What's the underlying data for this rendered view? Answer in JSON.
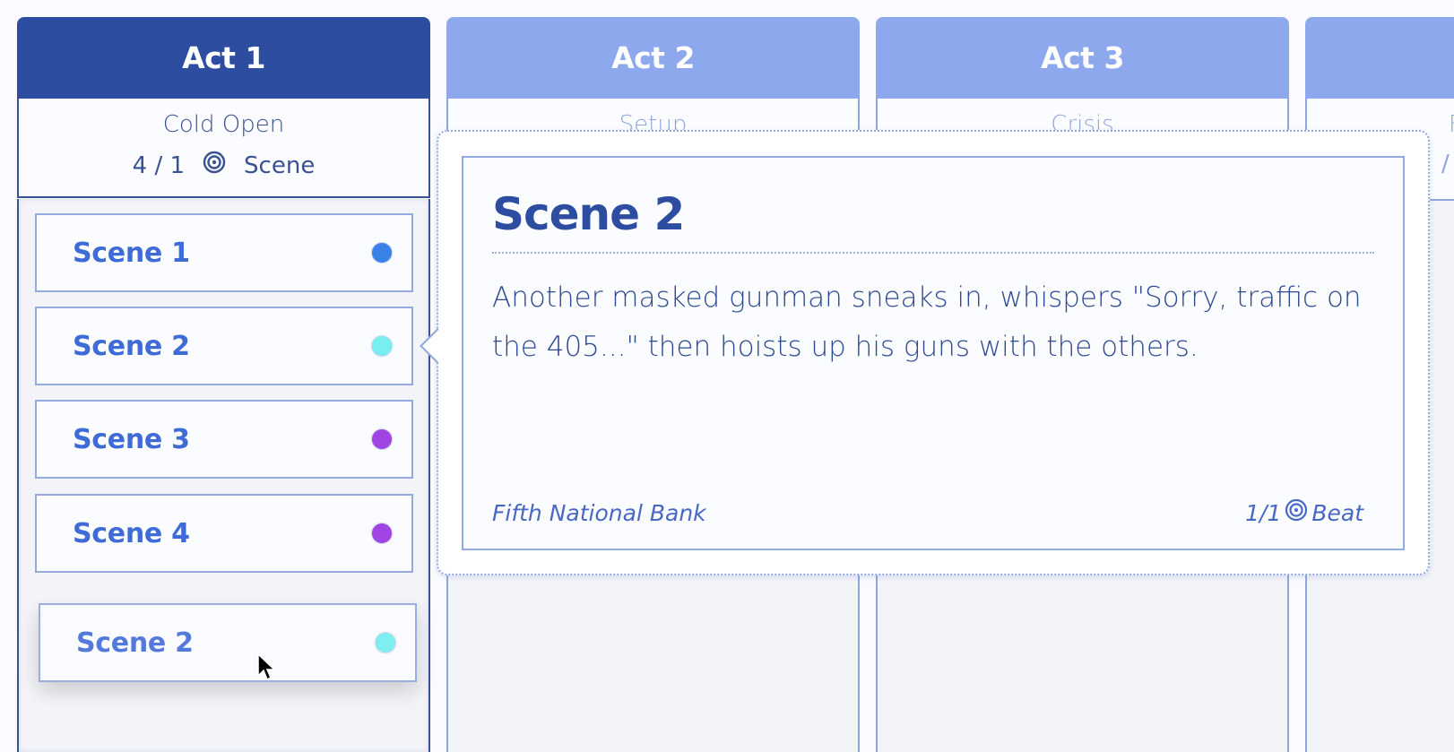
{
  "columns": [
    {
      "title": "Act 1",
      "subtitle": "Cold Open",
      "count": "4 / 1",
      "unit": "Scene",
      "state": "active"
    },
    {
      "title": "Act 2",
      "subtitle": "Setup",
      "count": "",
      "unit": "",
      "state": "inactive"
    },
    {
      "title": "Act 3",
      "subtitle": "Crisis",
      "count": "",
      "unit": "",
      "state": "inactive"
    },
    {
      "title": "",
      "subtitle": "F",
      "count": "/",
      "unit": "",
      "state": "inactive"
    }
  ],
  "scenes": [
    {
      "label": "Scene 1",
      "color": "#3b82e8"
    },
    {
      "label": "Scene 2",
      "color": "#78eef0"
    },
    {
      "label": "Scene 3",
      "color": "#a044e4"
    },
    {
      "label": "Scene 4",
      "color": "#a044e4"
    }
  ],
  "dragging_scene": {
    "label": "Scene 2",
    "color": "#78eef0"
  },
  "popover": {
    "title": "Scene 2",
    "description": "Another masked gunman sneaks in, whispers \"Sorry, traffic on the 405...\" then hoists up his guns with the others.",
    "location": "Fifth National Bank",
    "beat_count": "1/1",
    "beat_label": "Beat"
  },
  "icons": {
    "target": "target-icon",
    "cursor": "mouse-cursor-icon"
  },
  "colors": {
    "active_header": "#2c4da0",
    "inactive_header": "#8ea8ee",
    "scene_text": "#3f6bd6"
  }
}
